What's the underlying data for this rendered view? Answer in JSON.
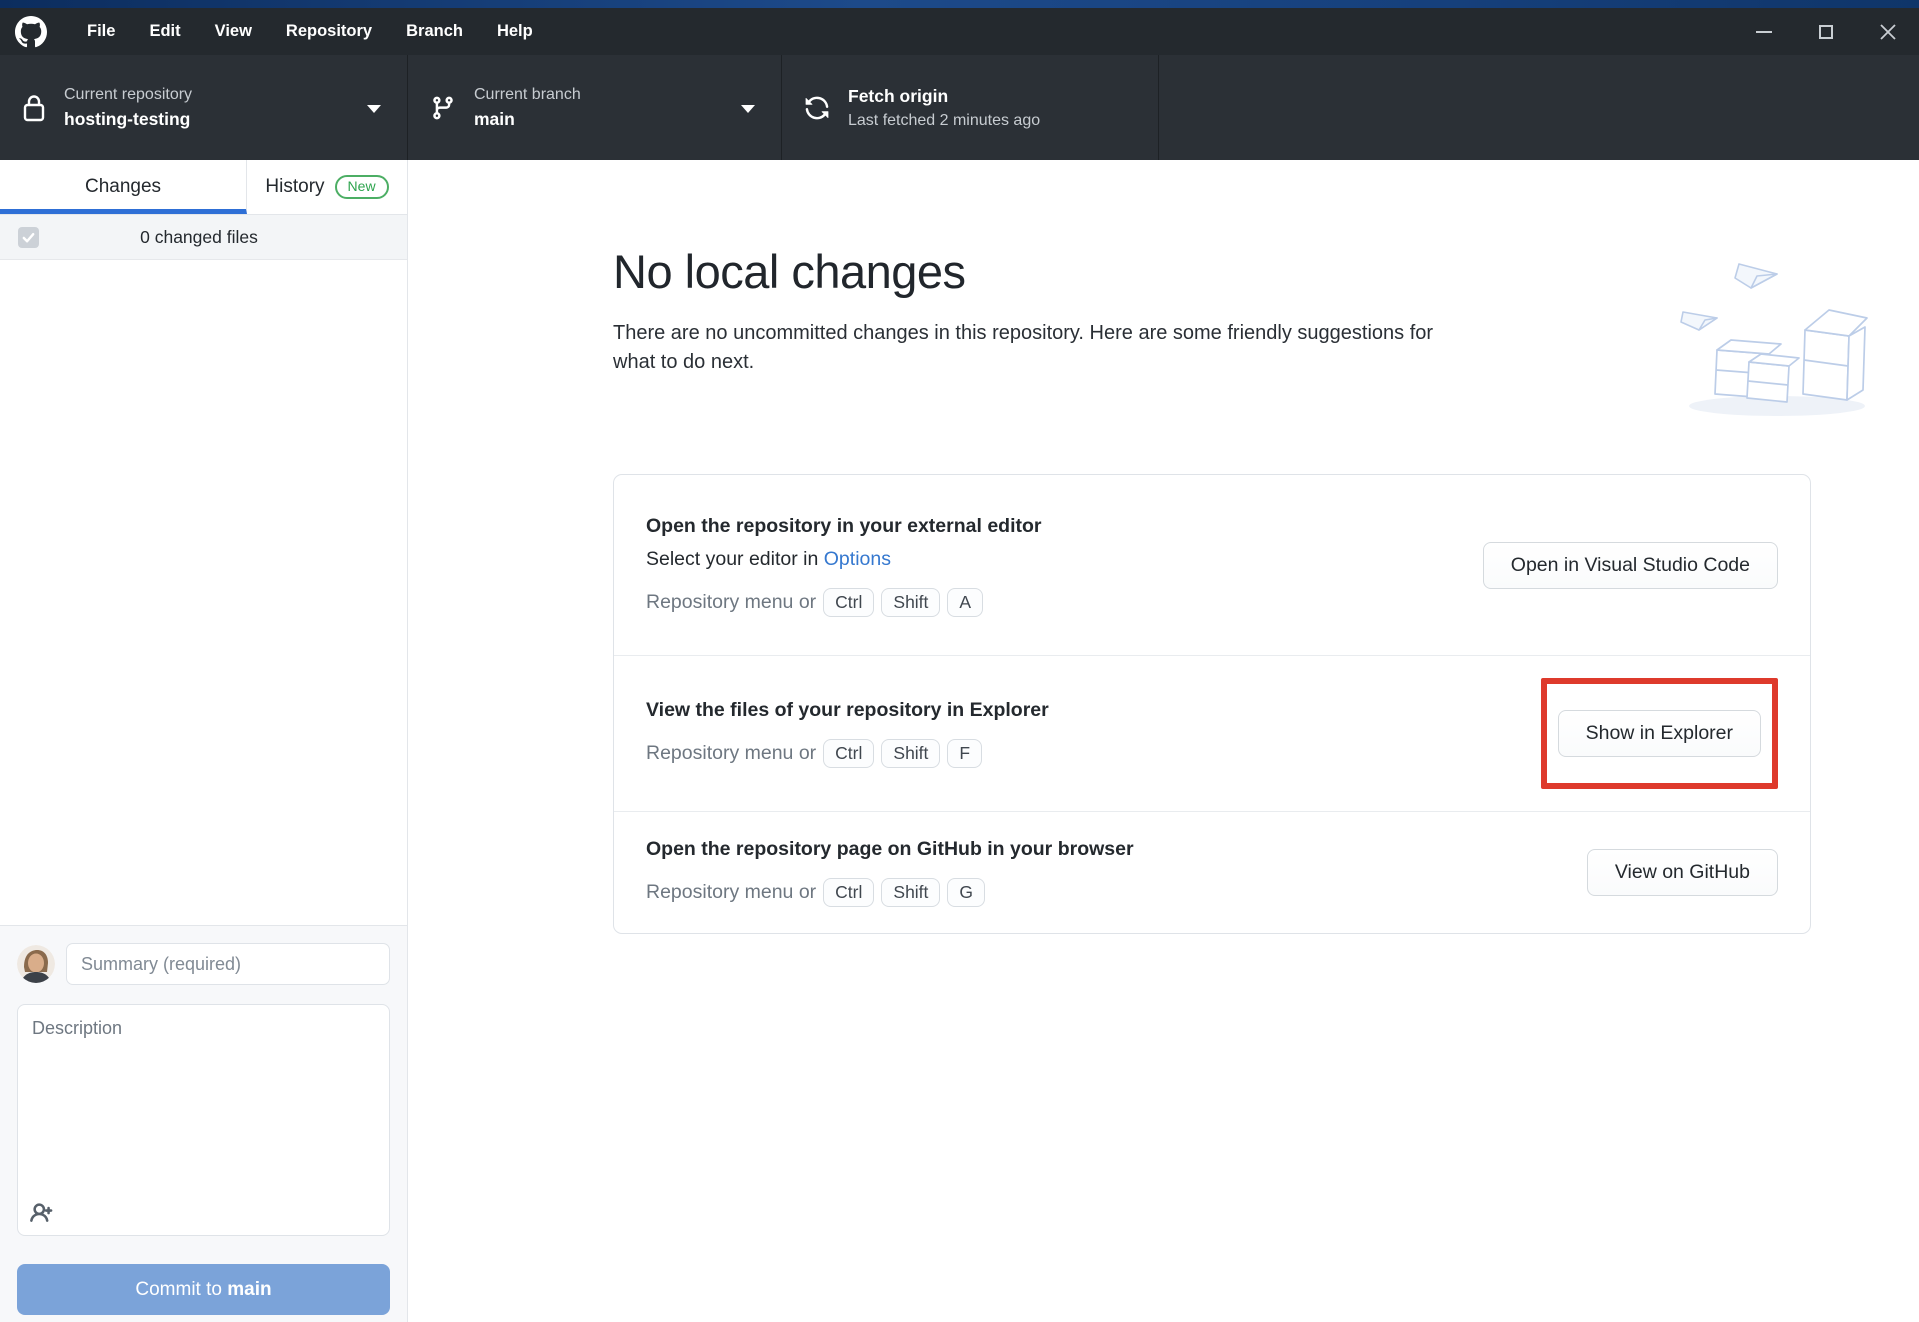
{
  "titlebar": {
    "menus": [
      "File",
      "Edit",
      "View",
      "Repository",
      "Branch",
      "Help"
    ]
  },
  "toolbar": {
    "repo": {
      "label": "Current repository",
      "value": "hosting-testing"
    },
    "branch": {
      "label": "Current branch",
      "value": "main"
    },
    "fetch": {
      "title": "Fetch origin",
      "subtitle": "Last fetched 2 minutes ago"
    }
  },
  "sidebar": {
    "tabs": {
      "changes": "Changes",
      "history": "History",
      "history_badge": "New"
    },
    "changed_files": "0 changed files",
    "commit": {
      "summary_placeholder": "Summary (required)",
      "description_placeholder": "Description",
      "button_prefix": "Commit to ",
      "button_branch": "main"
    }
  },
  "main": {
    "title": "No local changes",
    "subtitle": "There are no uncommitted changes in this repository. Here are some friendly suggestions for what to do next.",
    "cards": [
      {
        "title": "Open the repository in your external editor",
        "line2_prefix": "Select your editor in ",
        "line2_link": "Options",
        "hint": "Repository menu or",
        "keys": [
          "Ctrl",
          "Shift",
          "A"
        ],
        "button": "Open in Visual Studio Code"
      },
      {
        "title": "View the files of your repository in Explorer",
        "hint": "Repository menu or",
        "keys": [
          "Ctrl",
          "Shift",
          "F"
        ],
        "button": "Show in Explorer"
      },
      {
        "title": "Open the repository page on GitHub in your browser",
        "hint": "Repository menu or",
        "keys": [
          "Ctrl",
          "Shift",
          "G"
        ],
        "button": "View on GitHub"
      }
    ]
  },
  "colors": {
    "tab_underline": "#2e6fd6",
    "link": "#3578cf",
    "highlight_red": "#de3a2c",
    "commit_button": "#7ba3d9",
    "badge_green": "#2da44e",
    "titlebar_bg": "#24292e",
    "toolbar_bg": "#2b3036"
  }
}
